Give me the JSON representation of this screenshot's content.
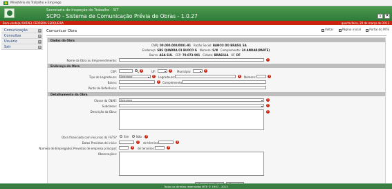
{
  "gov_bar": {
    "ministry": "Ministério do Trabalho e Emprego"
  },
  "header": {
    "subtitle": "Secretaria de Inspeção do Trabalho - SIT",
    "title": "SCPO - Sistema de Comunicação Prévia de Obras - 1.0.27",
    "font_smaller": "A",
    "font_larger": "A"
  },
  "user_bar": {
    "user": "Bem-vindo(a) RAFAEL FERREIRA SERQUEIRA",
    "date": "quarta-feira, 20 de março de 2013"
  },
  "sidebar": {
    "items": [
      {
        "label": "Comunicação"
      },
      {
        "label": "Consultas"
      },
      {
        "label": "Usuário"
      },
      {
        "label": "Sair"
      }
    ]
  },
  "main": {
    "title": "Comunicar Obra",
    "links": {
      "back": "Voltar",
      "home": "Página inicial",
      "portal": "Portal do MTE"
    }
  },
  "dados_obra": {
    "heading": "Dados da Obra",
    "cnpj_label": "CNPJ:",
    "cnpj": "00.000.000/0001-91",
    "razao_label": "Razão Social:",
    "razao": "BANCO DO BRASIL SA",
    "endereco_label": "Endereço:",
    "endereco": "SBS QUADRA 01 BLOCO G",
    "numero_label": "Número:",
    "numero": "S/N",
    "complemento_label": "Complemento:",
    "complemento": "24 ANDAR(PARTE)",
    "bairro_label": "Bairro:",
    "bairro": "ASA SUL",
    "cep_label": "CEP:",
    "cep": "70.073-901",
    "cidade_label": "Cidade:",
    "cidade": "BRASILIA",
    "uf_label": "UF:",
    "uf": "DF",
    "nome_label": "Nome da Obra ou Empreendimento:"
  },
  "endereco_obra": {
    "heading": "Endereço da Obra",
    "cep_label": "CEP:",
    "uf_label": "UF:",
    "municipio_label": "Município:",
    "tipo_logradouro_label": "Tipo de Logradouro:",
    "tipo_logradouro_value": "Selecione",
    "logradouro_label": "Logradouro:",
    "numero_label": "Número:",
    "bairro_label": "Bairro:",
    "complemento_label": "Complemento:",
    "ponto_referencia_label": "Ponto de Referência:"
  },
  "detalhamento": {
    "heading": "Detalhamento da Obra",
    "classe_label": "Classe da CNAE:",
    "classe_value": "Selecione",
    "subclasse_label": "Subclasse:",
    "subclasse_value": "",
    "descricao_label": "Descrição da Obra:",
    "financiada_label": "Obra financiada com recursos do FGTS?",
    "sim_label": "Sim",
    "nao_label": "Não",
    "datas_label": "Datas Previstas de início:",
    "termino_label": "de término:",
    "empregados_label": "Número de Empregados Previstos de empresa principal:",
    "terceiros_label": "de terceiros:",
    "observacoes_label": "Observações:"
  },
  "buttons": {
    "submit": "Comunicar Obra",
    "cancel": "Cancelar"
  },
  "footer": {
    "text": "Todos os direitos reservados MTE © 1997 - 2013"
  },
  "colors": {
    "header_green": "#2e7a3a",
    "user_bar_red": "#c9230f",
    "section_gray": "#bdbdbd"
  }
}
